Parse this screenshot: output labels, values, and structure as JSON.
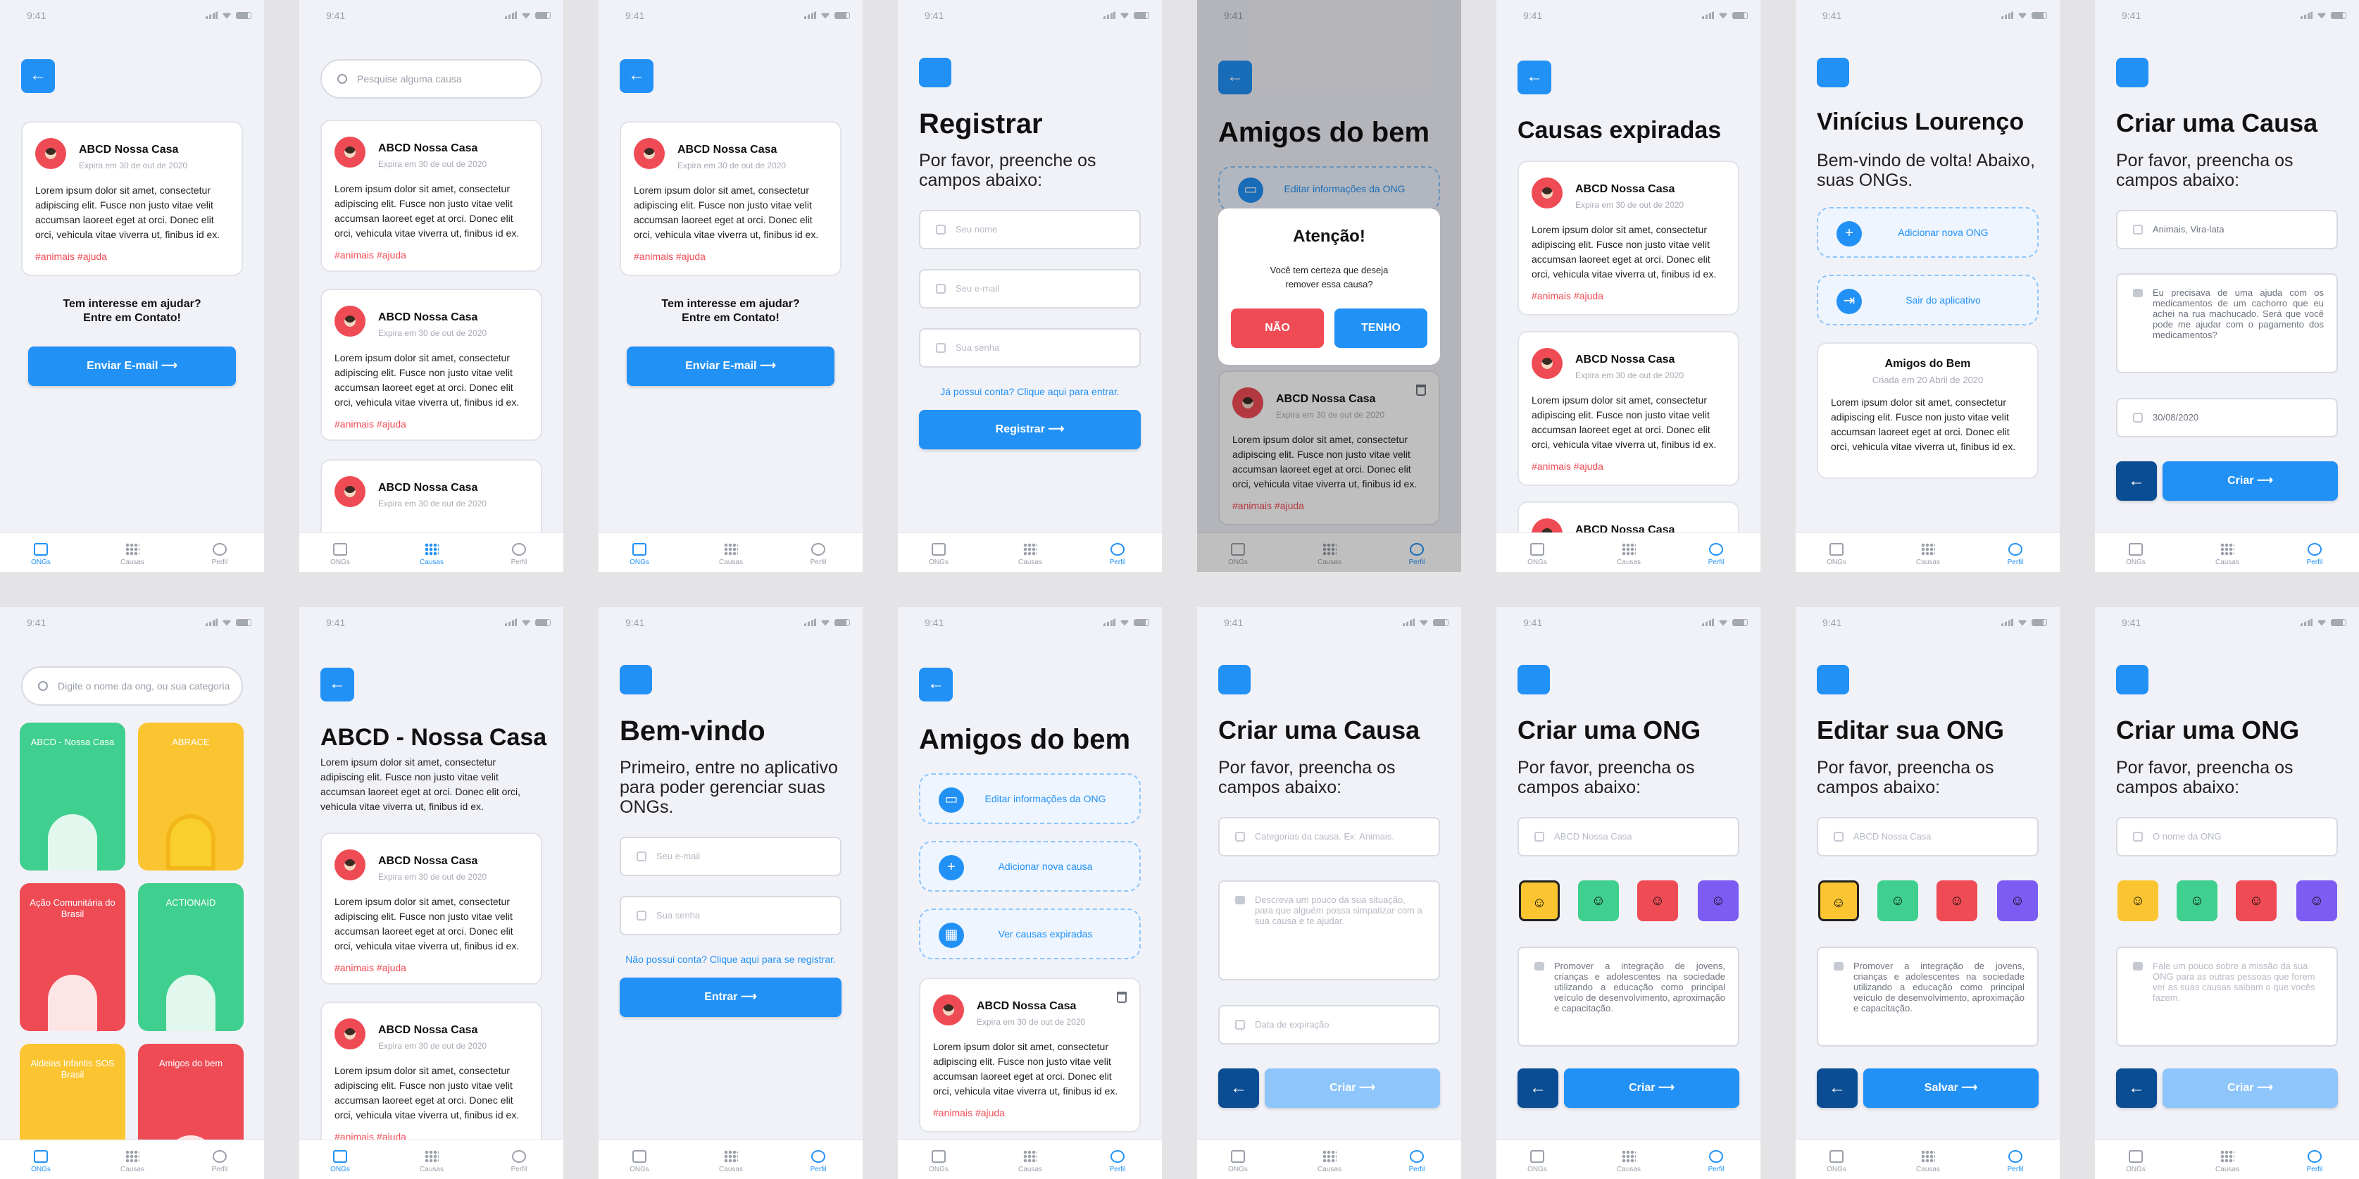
{
  "status": {
    "time": "9:41"
  },
  "tabs": {
    "ongs": "ONGs",
    "causas": "Causas",
    "perfil": "Perfil"
  },
  "cause_card": {
    "title": "ABCD Nossa Casa",
    "expires": "Expira em 30 de out de 2020",
    "body": "Lorem ipsum dolor sit amet, consectetur adipiscing elit. Fusce non justo vitae velit accumsan laoreet eget at orci. Donec elit orci, vehicula vitae viverra ut, finibus id ex.",
    "tags": "#animais #ajuda"
  },
  "contact": {
    "prompt_1": "Tem interesse em ajudar?",
    "prompt_2": "Entre em Contato!",
    "email_button": "Enviar E-mail"
  },
  "search": {
    "causes_placeholder": "Pesquise alguma causa",
    "ongs_placeholder": "Digite o nome da ong, ou sua categoria"
  },
  "register": {
    "title": "Registrar",
    "subtitle": "Por favor, preenche os campos abaixo:",
    "name": "Seu nome",
    "email": "Seu e-mail",
    "password": "Sua senha",
    "login_link": "Já possui conta? Clique aqui para entrar.",
    "button": "Registrar"
  },
  "friends": {
    "title": "Amigos do bem",
    "edit": "Editar informações da ONG",
    "add": "Adicionar nova causa",
    "expired": "Ver causas expiradas"
  },
  "modal": {
    "title": "Atenção!",
    "body": "Você tem certeza que deseja remover essa causa?",
    "no": "NÃO",
    "yes": "TENHO"
  },
  "expired": {
    "title": "Causas expiradas"
  },
  "profile": {
    "title": "Vinícius Lourenço",
    "subtitle": "Bem-vindo de volta! Abaixo, suas ONGs.",
    "add": "Adicionar nova ONG",
    "logout": "Sair do aplicativo",
    "card_title": "Amigos do Bem",
    "card_date": "Criada em 20 Abril de 2020"
  },
  "create_cause": {
    "title": "Criar uma Causa",
    "subtitle": "Por favor, preencha os campos abaixo:",
    "tags_filled": "Animais, Vira-lata",
    "desc_filled": "Eu precisava de uma ajuda com os medicamentos de um cachorro que eu achei na rua machucado. Será que você pode me ajudar com o pagamento dos medicamentos?",
    "date_filled": "30/08/2020",
    "tags_placeholder": "Categorias da causa. Ex: Animais.",
    "desc_placeholder": "Descreva um pouco da sua situação, para que alguém possa simpatizar com a sua causa e te ajudar.",
    "date_placeholder": "Data de expiração",
    "button": "Criar"
  },
  "ongs_list": [
    "ABCD - Nossa Casa",
    "ABRACE",
    "Ação Comunitária do Brasil",
    "ACTIONAID",
    "Aldeias Infantis SOS Brasil",
    "Amigos do bem"
  ],
  "ong_detail": {
    "title": "ABCD - Nossa Casa",
    "body": "Lorem ipsum dolor sit amet, consectetur adipiscing elit. Fusce non justo vitae velit accumsan laoreet eget at orci. Donec elit orci, vehicula vitae viverra ut, finibus id ex."
  },
  "login": {
    "title": "Bem-vindo",
    "subtitle": "Primeiro, entre no aplicativo para poder gerenciar suas ONGs.",
    "email": "Seu e-mail",
    "password": "Sua senha",
    "register_link": "Não possui conta? Clique aqui para se registrar.",
    "button": "Entrar"
  },
  "create_ong": {
    "title": "Criar uma ONG",
    "subtitle": "Por favor, preencha os campos abaixo:",
    "name_filled": "ABCD Nossa Casa",
    "name_placeholder": "O nome da ONG",
    "mission_filled": "Promover a integração de jovens, crianças e adolescentes na sociedade utilizando a educação como principal veículo de desenvolvimento, aproximação e capacitação.",
    "mission_placeholder": "Fale um pouco sobre a missão da sua ONG para as outras pessoas que forem ver as suas causas saibam o que vocês fazem.",
    "button": "Criar"
  },
  "edit_ong": {
    "title": "Editar sua ONG",
    "button": "Salvar"
  },
  "colors": {
    "primary": "#2291f5",
    "danger": "#ef4b55",
    "dark": "#0b4d93",
    "light": "#8ec5fb",
    "yellow": "#fbc531",
    "green": "#3fcf8e",
    "purple": "#7c5cf2"
  }
}
